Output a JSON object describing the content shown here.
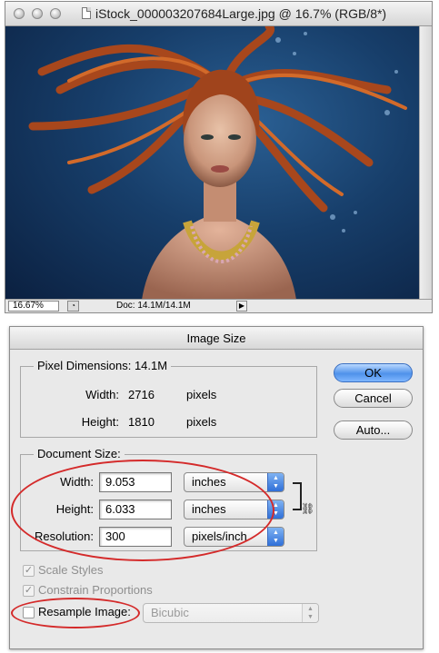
{
  "document_window": {
    "title": "iStock_000003207684Large.jpg @ 16.7% (RGB/8*)",
    "zoom": "16.67%",
    "doc_info": "Doc: 14.1M/14.1M"
  },
  "dialog": {
    "title": "Image Size",
    "pixel_dimensions": {
      "legend": "Pixel Dimensions:",
      "size": "14.1M",
      "width_label": "Width:",
      "width_value": "2716",
      "width_unit": "pixels",
      "height_label": "Height:",
      "height_value": "1810",
      "height_unit": "pixels"
    },
    "document_size": {
      "legend": "Document Size:",
      "width_label": "Width:",
      "width_value": "9.053",
      "width_unit": "inches",
      "height_label": "Height:",
      "height_value": "6.033",
      "height_unit": "inches",
      "resolution_label": "Resolution:",
      "resolution_value": "300",
      "resolution_unit": "pixels/inch"
    },
    "buttons": {
      "ok": "OK",
      "cancel": "Cancel",
      "auto": "Auto..."
    },
    "options": {
      "scale_styles": "Scale Styles",
      "constrain_proportions": "Constrain Proportions",
      "resample_image": "Resample Image:",
      "resample_method": "Bicubic"
    }
  },
  "colors": {
    "annotation": "#d42a2a",
    "default_button": "#4f92ea",
    "photo_background": "#173e6a"
  }
}
